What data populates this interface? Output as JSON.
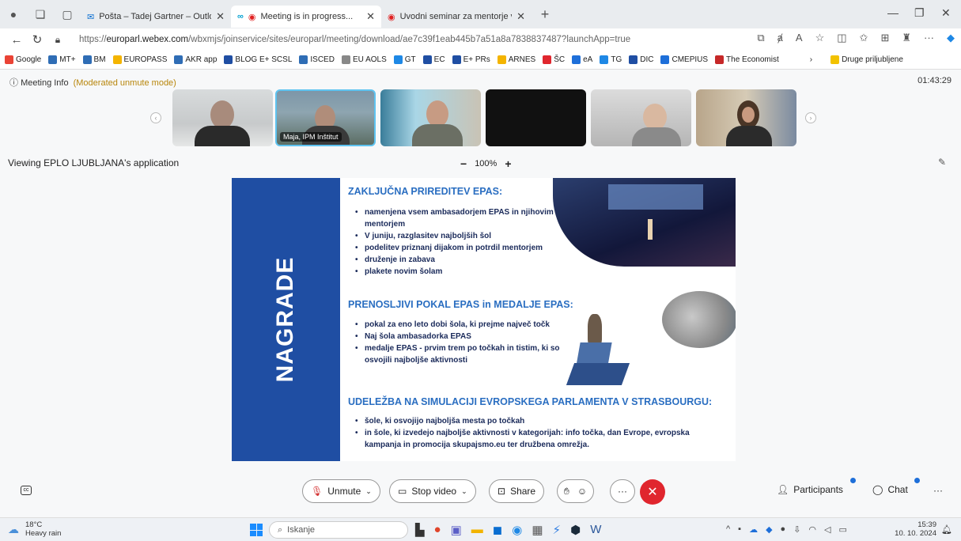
{
  "browser": {
    "tabs": [
      {
        "title": "Pošta – Tadej Gartner – Outlook"
      },
      {
        "title": "Meeting is in progress..."
      },
      {
        "title": "Uvodni seminar za mentorje v pro"
      }
    ],
    "url_prefix": "https://",
    "url_domain": "europarl.webex.com",
    "url_path": "/wbxmjs/joinservice/sites/europarl/meeting/download/ae7c39f1eab445b7a51a8a7838837487?launchApp=true",
    "bookmarks": [
      "Google",
      "MT+",
      "BM",
      "EUROPASS",
      "AKR app",
      "BLOG E+ SCSL",
      "ISCED",
      "EU AOLS",
      "GT",
      "EC",
      "E+ PRs",
      "ARNES",
      "ŠC",
      "eA",
      "TG",
      "DIC",
      "CMEPIUS",
      "The Economist"
    ],
    "other_bookmarks": "Druge priljubljene"
  },
  "meeting": {
    "info_label": "Meeting Info",
    "mode": "(Moderated unmute mode)",
    "timer": "01:43:29",
    "selected_participant": "Maja, IPM Inštitut",
    "viewing": "Viewing EPLO LJUBLJANA's application",
    "zoom_minus": "−",
    "zoom": "100%",
    "zoom_plus": "+"
  },
  "slide": {
    "side_title": "NAGRADE",
    "s1_title": "ZAKLJUČNA PRIREDITEV EPAS:",
    "s1_items": [
      "namenjena vsem ambasadorjem EPAS in njihovim mentorjem",
      "V juniju, razglasitev najboljših šol",
      "podelitev priznanj dijakom in potrdil mentorjem",
      "druženje in zabava",
      "plakete novim šolam"
    ],
    "s2_title": "PRENOSLJIVI POKAL EPAS in MEDALJE EPAS:",
    "s2_items": [
      "pokal za eno leto dobi šola, ki prejme največ točk",
      "Naj šola ambasadorka EPAS",
      "medalje EPAS - prvim trem po točkah in tistim, ki so osvojili najboljše aktivnosti"
    ],
    "s3_title": "UDELEŽBA NA SIMULACIJI EVROPSKEGA PARLAMENTA V STRASBOURGU:",
    "s3_items": [
      "šole, ki osvojijo najboljša mesta po točkah",
      "in šole, ki izvedejo najboljše aktivnosti v kategorijah: info točka, dan Evrope, evropska kampanja in promocija skupajsmo.eu ter družbena omrežja."
    ]
  },
  "controls": {
    "unmute": "Unmute",
    "stop_video": "Stop video",
    "share": "Share",
    "participants": "Participants",
    "chat": "Chat",
    "more": "···"
  },
  "taskbar": {
    "temp": "18°C",
    "weather": "Heavy rain",
    "search": "Iskanje",
    "time": "15:39",
    "date": "10. 10. 2024"
  }
}
